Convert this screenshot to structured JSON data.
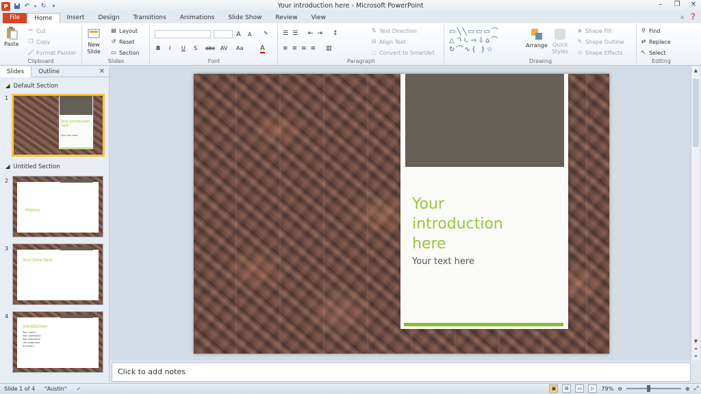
{
  "window": {
    "title": "Your introduction here - Microsoft PowerPoint"
  },
  "qat": {
    "logo": "P"
  },
  "tabs": [
    "Home",
    "Insert",
    "Design",
    "Transitions",
    "Animations",
    "Slide Show",
    "Review",
    "View"
  ],
  "file_tab": "File",
  "ribbon": {
    "clipboard": {
      "label": "Clipboard",
      "paste": "Paste",
      "cut": "Cut",
      "copy": "Copy",
      "format_painter": "Format Painter"
    },
    "slides": {
      "label": "Slides",
      "new_slide": "New",
      "new_slide2": "Slide",
      "layout": "Layout",
      "reset": "Reset",
      "section": "Section"
    },
    "font": {
      "label": "Font",
      "bold": "B",
      "italic": "I",
      "underline": "U",
      "shadow": "S",
      "strike": "abc",
      "spacing": "AV",
      "case": "Aa",
      "color": "A",
      "grow": "A",
      "shrink": "A"
    },
    "paragraph": {
      "label": "Paragraph",
      "text_direction": "Text Direction",
      "align_text": "Align Text",
      "convert_smartart": "Convert to SmartArt"
    },
    "drawing": {
      "label": "Drawing",
      "arrange": "Arrange",
      "quick_styles": "Quick",
      "quick_styles2": "Styles",
      "shape_fill": "Shape Fill",
      "shape_outline": "Shape Outline",
      "shape_effects": "Shape Effects"
    },
    "editing": {
      "label": "Editing",
      "find": "Find",
      "replace": "Replace",
      "select": "Select"
    }
  },
  "leftpane": {
    "tab_slides": "Slides",
    "tab_outline": "Outline",
    "sections": [
      "Default Section",
      "Untitled Section"
    ],
    "thumbnails": [
      {
        "num": "1",
        "title": "Your introduction here",
        "sub": "Your text here"
      },
      {
        "num": "2",
        "title": "History"
      },
      {
        "num": "3",
        "title": "Your time here"
      },
      {
        "num": "4",
        "title": "Introduction",
        "bullets": [
          "Your name",
          "Your profession",
          "Your education",
          "Life statement",
          "Summary"
        ]
      }
    ]
  },
  "slide": {
    "title_line1": "Your",
    "title_line2": "introduction",
    "title_line3": "here",
    "subtitle": "Your text here"
  },
  "notes": {
    "placeholder": "Click to add notes"
  },
  "status": {
    "slide_info": "Slide 1 of 4",
    "theme": "\"Austin\"",
    "zoom": "79%",
    "zoom_level": 0.79
  },
  "colors": {
    "accent_green": "#9bc43a",
    "bar_green": "#8cbd26",
    "card_top": "#665f56",
    "file_tab": "#d24726"
  }
}
